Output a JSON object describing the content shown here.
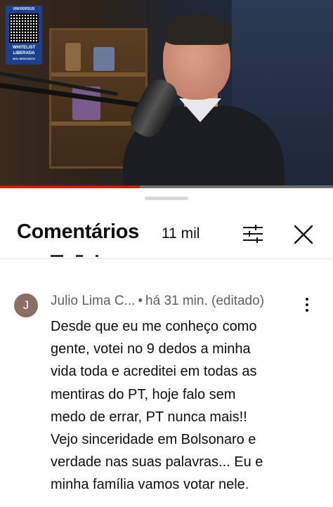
{
  "video": {
    "overlay": {
      "header": "UNIVERSUS",
      "line1": "WHITELIST",
      "line2": "LIBERADA",
      "line3": "80% DESCONTO"
    },
    "progress_fraction": 0.42,
    "progress_color": "#ff0000"
  },
  "comments_panel": {
    "title": "Comentários",
    "count": "11 mil",
    "filter_icon": "sliders-icon",
    "close_icon": "close-icon"
  },
  "comment": {
    "avatar_letter": "J",
    "avatar_color": "#8d6e63",
    "author": "Julio Lima C...",
    "separator": "•",
    "time": "há 31 min. (editado)",
    "text_lines": [
      "Desde que eu me conheço como",
      "gente, votei no 9 dedos a minha",
      "vida toda e acreditei em todas as",
      "mentiras do PT, hoje falo sem",
      "medo de errar, PT nunca mais!!",
      "Vejo sinceridade em Bolsonaro e",
      "verdade nas suas palavras... Eu e",
      "minha família vamos votar nele."
    ]
  }
}
